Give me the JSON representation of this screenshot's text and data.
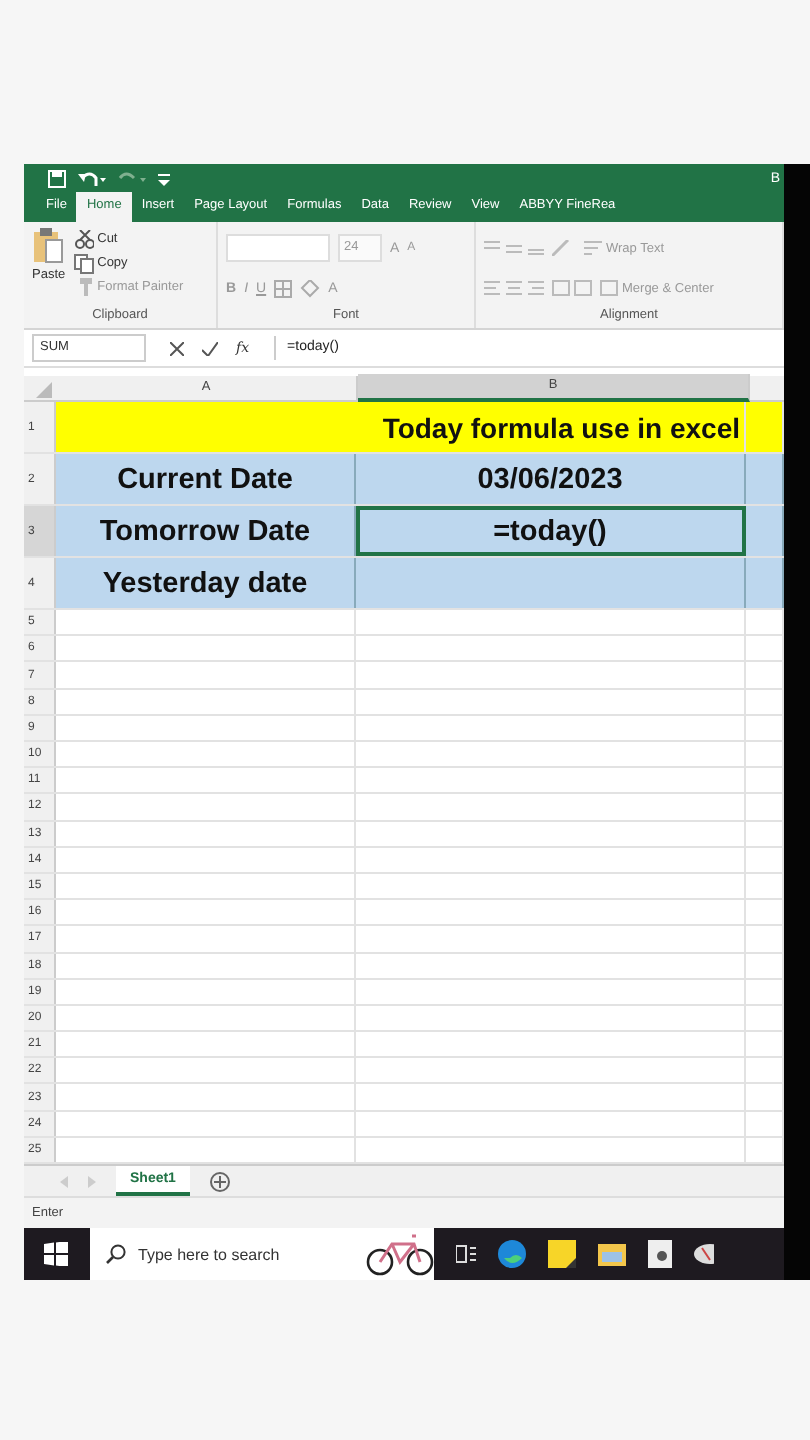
{
  "title_bar": {
    "title": "B"
  },
  "tabs": [
    {
      "label": "File",
      "selected": false
    },
    {
      "label": "Home",
      "selected": true
    },
    {
      "label": "Insert",
      "selected": false
    },
    {
      "label": "Page Layout",
      "selected": false
    },
    {
      "label": "Formulas",
      "selected": false
    },
    {
      "label": "Data",
      "selected": false
    },
    {
      "label": "Review",
      "selected": false
    },
    {
      "label": "View",
      "selected": false
    },
    {
      "label": "ABBYY FineRea",
      "selected": false
    }
  ],
  "ribbon": {
    "clipboard": {
      "paste": "Paste",
      "cut": "Cut",
      "copy": "Copy",
      "format_painter": "Format Painter",
      "label": "Clipboard"
    },
    "font": {
      "size": "24",
      "grow": "A",
      "shrink": "A",
      "bold": "B",
      "italic": "I",
      "underline": "U",
      "font_color": "A",
      "label": "Font"
    },
    "alignment": {
      "wrap_text": "Wrap Text",
      "merge": "Merge & Center",
      "label": "Alignment"
    }
  },
  "formula_bar": {
    "name_box": "SUM",
    "function_symbol": "fx",
    "formula": "=today()"
  },
  "columns": [
    "A",
    "B"
  ],
  "rows": [
    {
      "number": "1",
      "kind": "title",
      "text": "Today formula use in excel"
    },
    {
      "number": "2",
      "kind": "pair",
      "cells": [
        "Current Date",
        "03/06/2023"
      ],
      "selected": false
    },
    {
      "number": "3",
      "kind": "pair",
      "cells": [
        "Tomorrow Date",
        "=today()"
      ],
      "selected": true
    },
    {
      "number": "4",
      "kind": "pair",
      "cells": [
        "Yesterday date"
      ],
      "selected": false
    },
    {
      "number": "5",
      "kind": "empty"
    },
    {
      "number": "6",
      "kind": "empty"
    },
    {
      "number": "7",
      "kind": "empty"
    },
    {
      "number": "8",
      "kind": "empty"
    },
    {
      "number": "9",
      "kind": "empty"
    },
    {
      "number": "10",
      "kind": "empty"
    },
    {
      "number": "11",
      "kind": "empty"
    },
    {
      "number": "12",
      "kind": "empty"
    },
    {
      "number": "13",
      "kind": "empty"
    },
    {
      "number": "14",
      "kind": "empty"
    },
    {
      "number": "15",
      "kind": "empty"
    },
    {
      "number": "16",
      "kind": "empty"
    },
    {
      "number": "17",
      "kind": "empty"
    },
    {
      "number": "18",
      "kind": "empty"
    },
    {
      "number": "19",
      "kind": "empty"
    },
    {
      "number": "20",
      "kind": "empty"
    },
    {
      "number": "21",
      "kind": "empty"
    },
    {
      "number": "22",
      "kind": "empty"
    },
    {
      "number": "23",
      "kind": "empty"
    },
    {
      "number": "24",
      "kind": "empty"
    },
    {
      "number": "25",
      "kind": "empty"
    }
  ],
  "sheet_tabs": [
    {
      "label": "Sheet1",
      "selected": true
    }
  ],
  "status_bar": "Enter",
  "taskbar": {
    "search_placeholder": "Type here to search"
  }
}
